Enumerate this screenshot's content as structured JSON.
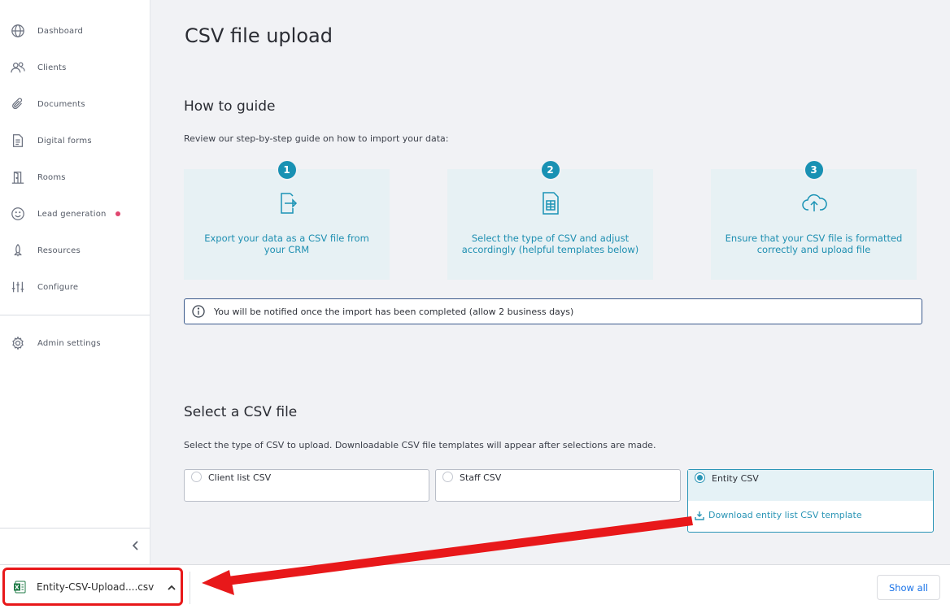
{
  "sidebar": {
    "items": [
      {
        "label": "Dashboard",
        "icon": "globe-icon"
      },
      {
        "label": "Clients",
        "icon": "users-icon"
      },
      {
        "label": "Documents",
        "icon": "paperclip-icon"
      },
      {
        "label": "Digital forms",
        "icon": "form-icon"
      },
      {
        "label": "Rooms",
        "icon": "door-icon"
      },
      {
        "label": "Lead generation",
        "icon": "smile-icon",
        "badge": "notification-dot"
      },
      {
        "label": "Resources",
        "icon": "rocket-icon"
      },
      {
        "label": "Configure",
        "icon": "sliders-icon"
      }
    ],
    "admin": {
      "label": "Admin settings",
      "icon": "gear-icon"
    }
  },
  "page": {
    "title": "CSV file upload",
    "guide": {
      "heading": "How to guide",
      "description": "Review our step-by-step guide on how to import your data:",
      "steps": [
        {
          "number": "1",
          "text": "Export your data as a CSV file from your CRM",
          "icon": "file-export-icon"
        },
        {
          "number": "2",
          "text": "Select the type of CSV and adjust accordingly (helpful templates below)",
          "icon": "spreadsheet-icon"
        },
        {
          "number": "3",
          "text": "Ensure that your CSV file is formatted correctly and upload file",
          "icon": "cloud-upload-icon"
        }
      ],
      "notice": "You will be notified once the import has been completed (allow 2 business days)"
    },
    "select": {
      "heading": "Select a CSV file",
      "description": "Select the type of CSV to upload. Downloadable CSV file templates will appear after selections are made.",
      "options": [
        {
          "label": "Client list CSV",
          "selected": false
        },
        {
          "label": "Staff CSV",
          "selected": false
        },
        {
          "label": "Entity CSV",
          "selected": true
        }
      ],
      "download_link": "Download entity list CSV template"
    }
  },
  "download_bar": {
    "file_name": "Entity-CSV-Upload....csv",
    "show_all": "Show all"
  },
  "colors": {
    "accent": "#1a93b5",
    "annotation": "#e8181a",
    "badge": "#e0466e"
  }
}
